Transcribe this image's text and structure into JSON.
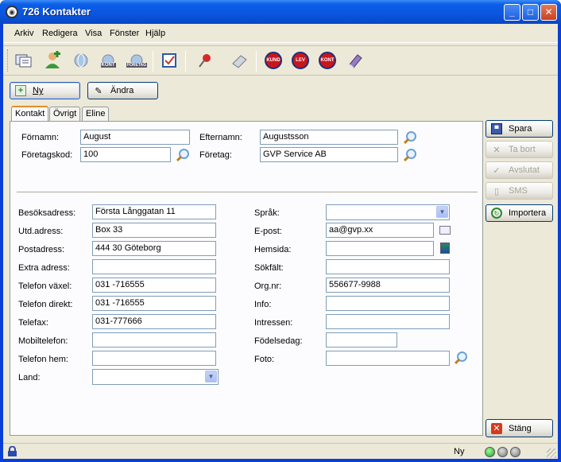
{
  "window": {
    "title": "726 Kontakter",
    "minimize": "_",
    "maximize": "□",
    "close": "✕"
  },
  "menu": [
    "Arkiv",
    "Redigera",
    "Visa",
    "Fönster",
    "Hjälp"
  ],
  "toolbar": {
    "icons": [
      "cards-icon",
      "add-person-icon",
      "globe-icon",
      "globe-kont-icon",
      "globe-foretag-icon",
      "checklist-icon",
      "pin-icon",
      "eraser-icon",
      "kund-icon",
      "lev-icon",
      "kont-icon",
      "book-icon"
    ],
    "globe_kont_label": "KONT",
    "globe_foretag_label": "FÖRETAG",
    "kund_label": "KUND",
    "lev_label": "LEV",
    "kont_label": "KONT"
  },
  "actions": {
    "new": "Ny",
    "edit": "Ändra"
  },
  "tabs": [
    "Kontakt",
    "Övrigt",
    "Eline"
  ],
  "header": {
    "fornamn_label": "Förnamn:",
    "fornamn": "August",
    "efternamn_label": "Efternamn:",
    "efternamn": "Augustsson",
    "foretagskod_label": "Företagskod:",
    "foretagskod": "100",
    "foretag_label": "Företag:",
    "foretag": "GVP Service AB"
  },
  "left": [
    {
      "label": "Besöksadress:",
      "value": "Första Långgatan 11"
    },
    {
      "label": "Utd.adress:",
      "value": "Box 33"
    },
    {
      "label": "Postadress:",
      "value": "444 30 Göteborg"
    },
    {
      "label": "Extra adress:",
      "value": ""
    },
    {
      "label": "Telefon växel:",
      "value": "031 -716555"
    },
    {
      "label": "Telefon direkt:",
      "value": "031 -716555"
    },
    {
      "label": "Telefax:",
      "value": "031-777666"
    },
    {
      "label": "Mobiltelefon:",
      "value": ""
    },
    {
      "label": "Telefon hem:",
      "value": ""
    },
    {
      "label": "Land:",
      "value": ""
    }
  ],
  "right": [
    {
      "label": "Språk:",
      "value": ""
    },
    {
      "label": "E-post:",
      "value": "aa@gvp.xx"
    },
    {
      "label": "Hemsida:",
      "value": ""
    },
    {
      "label": "Sökfält:",
      "value": ""
    },
    {
      "label": "Org.nr:",
      "value": "556677-9988"
    },
    {
      "label": "Info:",
      "value": ""
    },
    {
      "label": "Intressen:",
      "value": ""
    },
    {
      "label": "Födelsedag:",
      "value": ""
    },
    {
      "label": "Foto:",
      "value": ""
    }
  ],
  "side": {
    "spara": "Spara",
    "tabort": "Ta bort",
    "avslutat": "Avslutat",
    "sms": "SMS",
    "importera": "Importera",
    "stang": "Stäng"
  },
  "status": {
    "mode": "Ny"
  }
}
